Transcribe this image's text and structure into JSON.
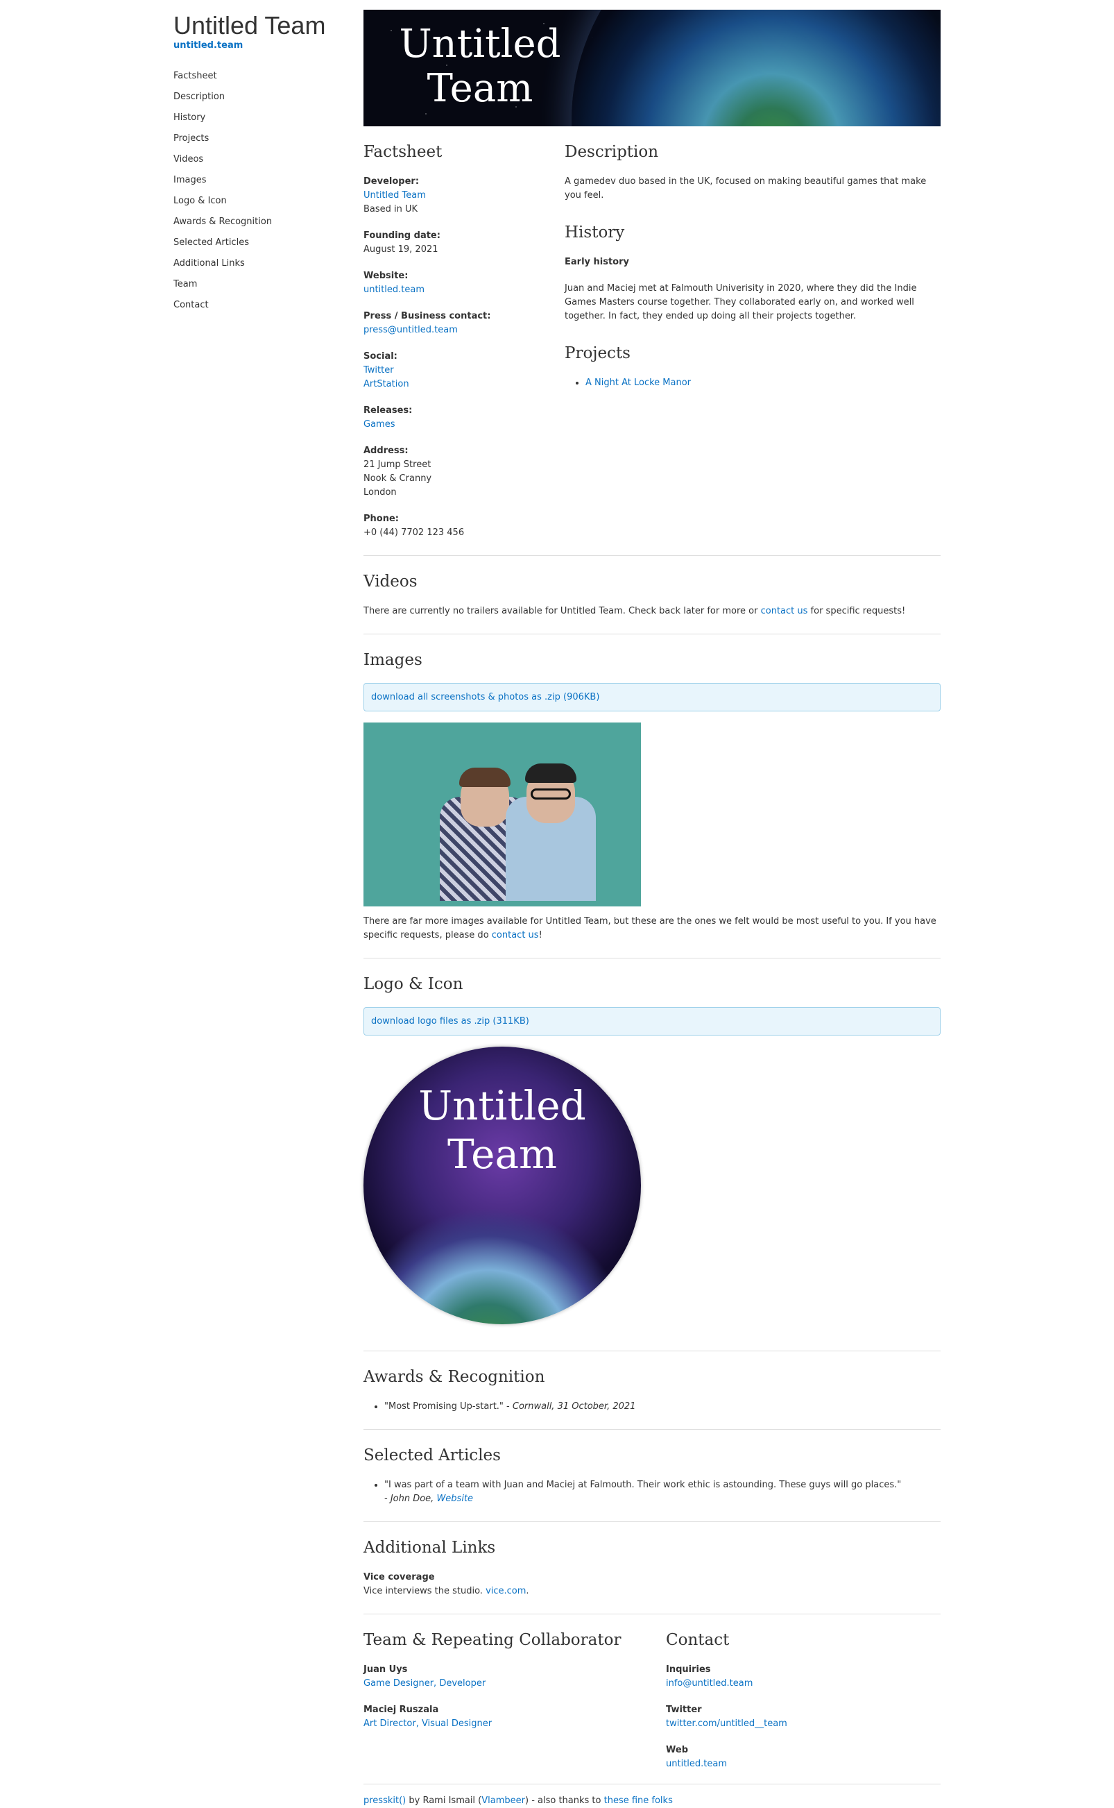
{
  "sidebar": {
    "title": "Untitled Team",
    "site": "untitled.team",
    "nav": [
      "Factsheet",
      "Description",
      "History",
      "Projects",
      "Videos",
      "Images",
      "Logo & Icon",
      "Awards & Recognition",
      "Selected Articles",
      "Additional Links",
      "Team",
      "Contact"
    ]
  },
  "header": {
    "title": "Untitled Team"
  },
  "factsheet": {
    "heading": "Factsheet",
    "developer_label": "Developer:",
    "developer": "Untitled Team",
    "developer_loc": "Based in UK",
    "founding_label": "Founding date:",
    "founding": "August 19, 2021",
    "website_label": "Website:",
    "website": "untitled.team",
    "press_label": "Press / Business contact:",
    "press": "press@untitled.team",
    "social_label": "Social:",
    "social1": "Twitter",
    "social2": "ArtStation",
    "releases_label": "Releases:",
    "releases": "Games",
    "address_label": "Address:",
    "address1": "21 Jump Street",
    "address2": "Nook & Cranny",
    "address3": "London",
    "phone_label": "Phone:",
    "phone": "+0 (44) 7702 123 456"
  },
  "description": {
    "heading": "Description",
    "text": "A gamedev duo based in the UK, focused on making beautiful games that make you feel."
  },
  "history": {
    "heading": "History",
    "sub": "Early history",
    "text": "Juan and Maciej met at Falmouth Univerisity in 2020, where they did the Indie Games Masters course together. They collaborated early on, and worked well together. In fact, they ended up doing all their projects together."
  },
  "projects": {
    "heading": "Projects",
    "items": [
      "A Night At Locke Manor"
    ]
  },
  "videos": {
    "heading": "Videos",
    "text_before": "There are currently no trailers available for Untitled Team. Check back later for more or ",
    "link": "contact us",
    "text_after": " for specific requests!"
  },
  "images": {
    "heading": "Images",
    "download": "download all screenshots & photos as .zip (906KB)",
    "text_before": "There are far more images available for Untitled Team, but these are the ones we felt would be most useful to you. If you have specific requests, please do ",
    "link": "contact us",
    "text_after": "!"
  },
  "logo": {
    "heading": "Logo & Icon",
    "download": "download logo files as .zip (311KB)",
    "circle_text": "Untitled Team"
  },
  "awards": {
    "heading": "Awards & Recognition",
    "quote": "\"Most Promising Up-start.\" - ",
    "source": "Cornwall, 31 October, 2021"
  },
  "articles": {
    "heading": "Selected Articles",
    "quote": "\"I was part of a team with Juan and Maciej at Falmouth. Their work ethic is astounding. These guys will go places.\"",
    "author": "- John Doe, ",
    "link": "Website"
  },
  "links": {
    "heading": "Additional Links",
    "title": "Vice coverage",
    "text": "Vice interviews the studio. ",
    "link": "vice.com",
    "after": "."
  },
  "team": {
    "heading": "Team & Repeating Collaborator",
    "m1_name": "Juan Uys",
    "m1_role": "Game Designer, Developer",
    "m2_name": "Maciej Ruszala",
    "m2_role": "Art Director, Visual Designer"
  },
  "contact": {
    "heading": "Contact",
    "inq_label": "Inquiries",
    "inq": "info@untitled.team",
    "tw_label": "Twitter",
    "tw": "twitter.com/untitled__team",
    "web_label": "Web",
    "web": "untitled.team"
  },
  "footer": {
    "presskit": "presskit()",
    "by": " by Rami Ismail (",
    "vlambeer": "Vlambeer",
    "thanks": ") - also thanks to ",
    "folks": "these fine folks"
  }
}
